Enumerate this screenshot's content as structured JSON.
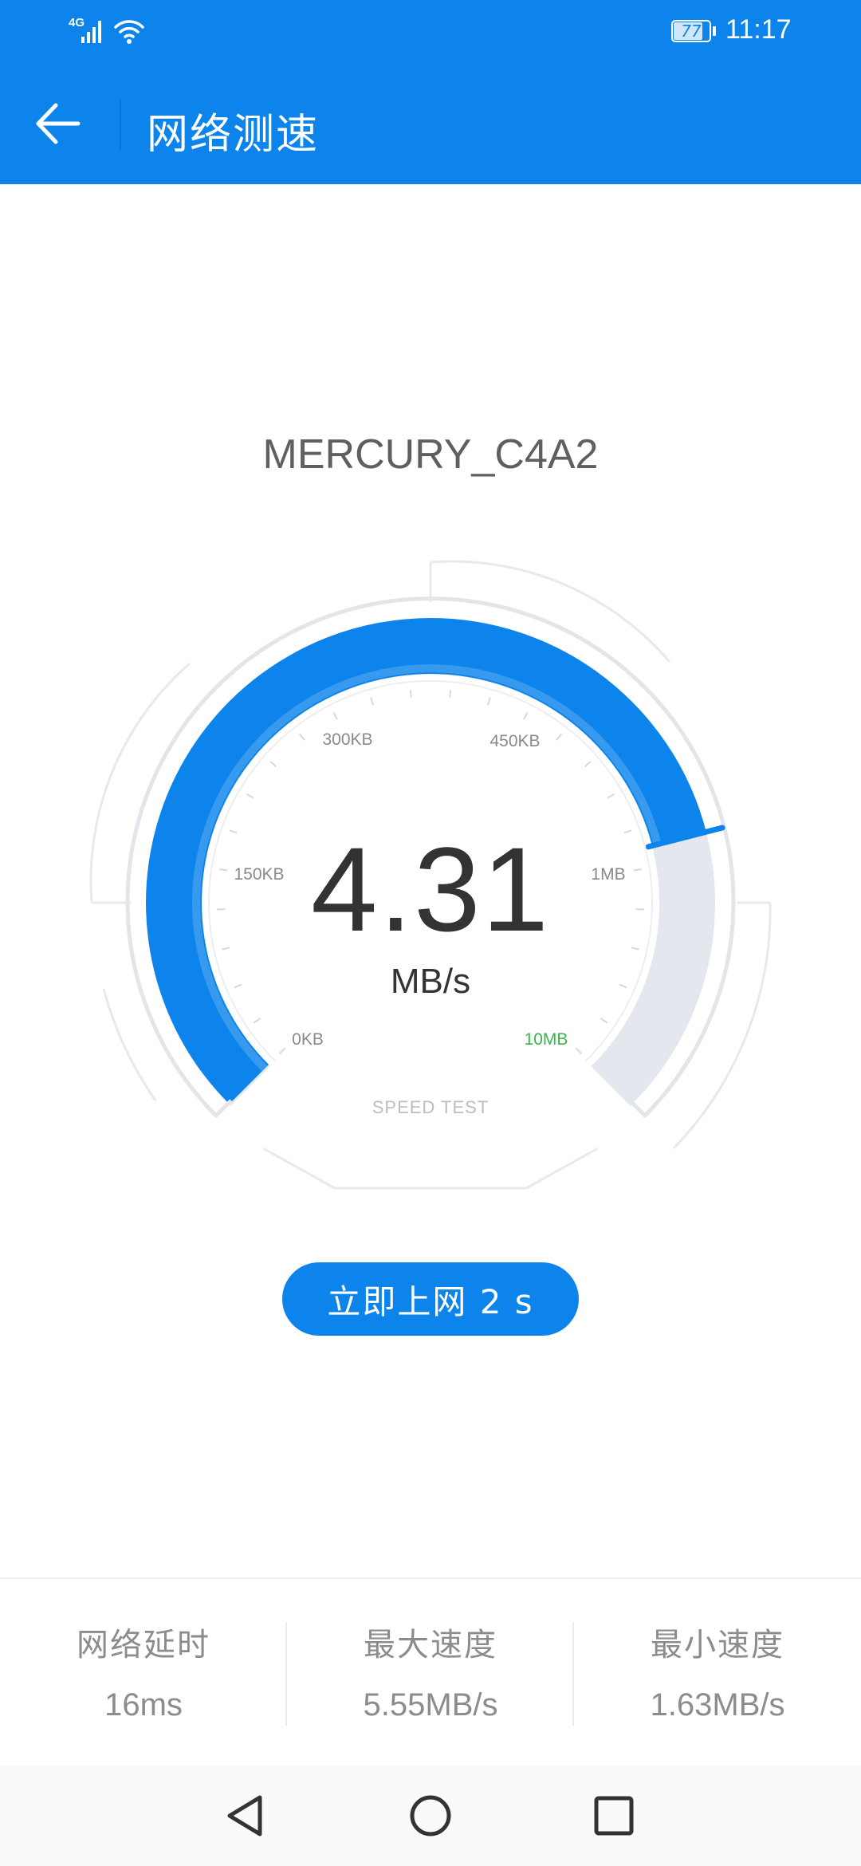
{
  "status_bar": {
    "network": "4G",
    "battery": "77",
    "time": "11:17",
    "icons": [
      "signal-icon",
      "wifi-icon",
      "battery-icon"
    ]
  },
  "header": {
    "back_icon": "arrow-left-icon",
    "title": "网络测速"
  },
  "ssid": "MERCURY_C4A2",
  "gauge": {
    "current_speed": "4.31",
    "unit": "MB/s",
    "ticks": [
      "0KB",
      "150KB",
      "300KB",
      "450KB",
      "1MB",
      "10MB"
    ],
    "caption": "SPEED TEST",
    "progress_fraction": 0.78,
    "colors": {
      "accent": "#0d84ec",
      "track": "#e4e8ee",
      "max_label": "#35b84a"
    }
  },
  "action_button": {
    "label": "立即上网 2 s"
  },
  "stats": [
    {
      "label": "网络延时",
      "value": "16ms"
    },
    {
      "label": "最大速度",
      "value": "5.55MB/s"
    },
    {
      "label": "最小速度",
      "value": "1.63MB/s"
    }
  ],
  "nav_bar": {
    "icons": [
      "nav-back-icon",
      "nav-home-icon",
      "nav-recents-icon"
    ]
  }
}
